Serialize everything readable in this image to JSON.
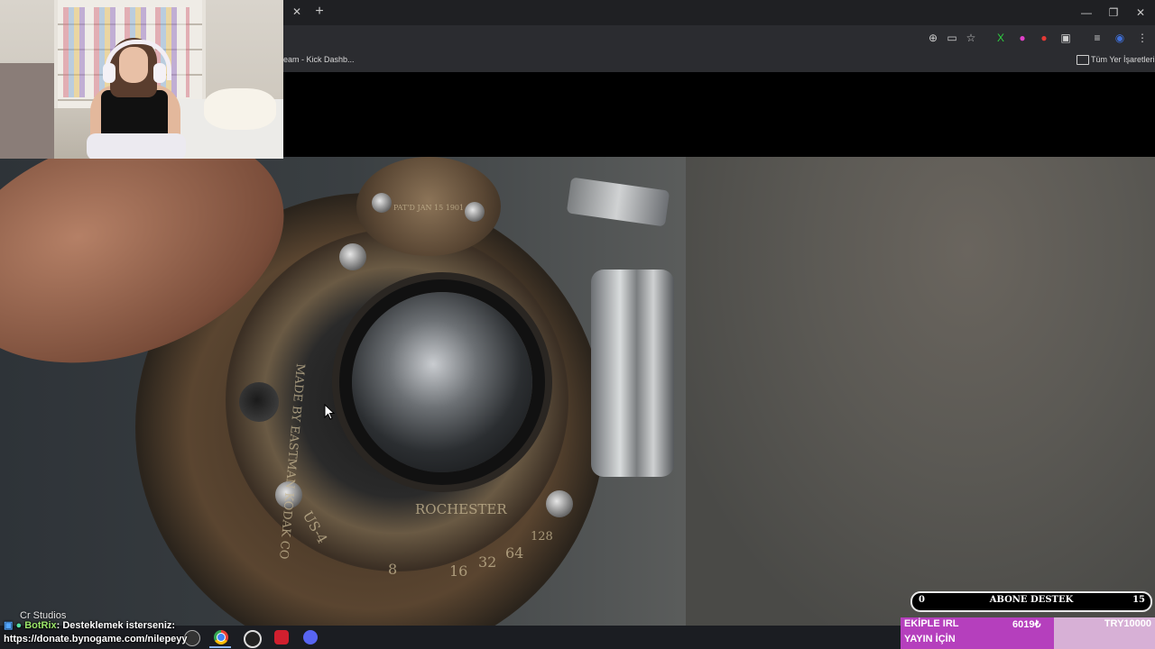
{
  "browser": {
    "tab_close": "✕",
    "tab_new": "+",
    "window_controls": {
      "minimize": "—",
      "restore": "❐",
      "close": "✕"
    },
    "toolbar_icons": [
      "zoom-icon",
      "cast-icon",
      "star-icon",
      "extension-x-icon",
      "extension-pink-icon",
      "extension-red-icon",
      "extensions-puzzle-icon",
      "media-icon",
      "profile-icon",
      "menu-icon"
    ],
    "bookmark_partial": "eam - Kick Dashb...",
    "all_bookmarks": "Tüm Yer İşaretleri"
  },
  "video": {
    "engraving": [
      "MADE BY EASTMAN KODAK CO",
      "ROCHESTER",
      "US-4",
      "8",
      "16",
      "32",
      "64",
      "128"
    ],
    "badge_text": "PAT'D JAN 15 1901"
  },
  "overlay": {
    "cr_studios": "Cr Studios",
    "chat": {
      "name": "BotRix",
      "message": ": Desteklemek isterseniz:",
      "link": "https://donate.bynogame.com/nilepeyy"
    },
    "sub_goal": {
      "current": "0",
      "label": "ABONE DESTEK",
      "target": "15"
    },
    "donation_goal": {
      "title_line1": "EKİPLE IRL",
      "title_line2": "YAYIN İÇİN",
      "current": "6019₺",
      "target": "TRY10000",
      "progress": 0.6019
    }
  },
  "taskbar": {
    "icons": [
      "app-icon",
      "chrome-icon",
      "obs-icon",
      "red-app-icon",
      "discord-icon"
    ]
  }
}
